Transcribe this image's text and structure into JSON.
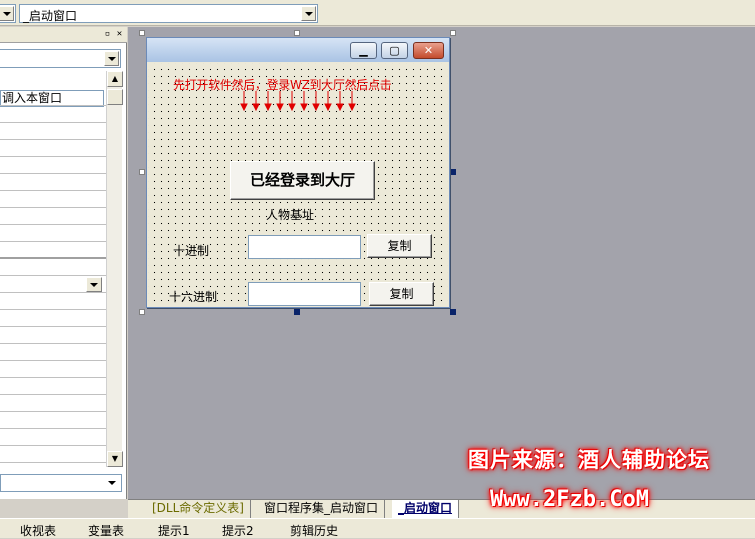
{
  "toolbar": {
    "combo_left_value": "",
    "combo_right_value": "_启动窗口"
  },
  "properties_panel": {
    "first_row_value": "调入本窗口",
    "panel_buttons": [
      "pin-icon",
      "close-icon"
    ]
  },
  "form": {
    "hint_text": "先打开软件然后，登录WZ到大厅然后点击",
    "login_button_label": "已经登录到大厅",
    "base_address_label": "人物基址",
    "decimal_label": "十进制",
    "hex_label": "十六进制",
    "copy_decimal_label": "复制",
    "copy_hex_label": "复制",
    "decimal_value": "",
    "hex_value": "",
    "title_buttons": [
      "minimize-icon",
      "maximize-icon",
      "close-icon"
    ]
  },
  "tabs": [
    {
      "label": "[DLL命令定义表]",
      "active": false
    },
    {
      "label": "窗口程序集_启动窗口",
      "active": false
    },
    {
      "label": "_启动窗口",
      "active": true
    }
  ],
  "statusbar": {
    "items": [
      "收视表",
      "变量表",
      "提示1",
      "提示2",
      "剪辑历史"
    ]
  },
  "watermark": {
    "line1": "图片来源：酒人辅助论坛",
    "line2": "Www.2Fzb.CoM"
  },
  "colors": {
    "hint": "#e00000",
    "canvas": "#a3a3ab",
    "watermark_glow": "#ff0000"
  }
}
